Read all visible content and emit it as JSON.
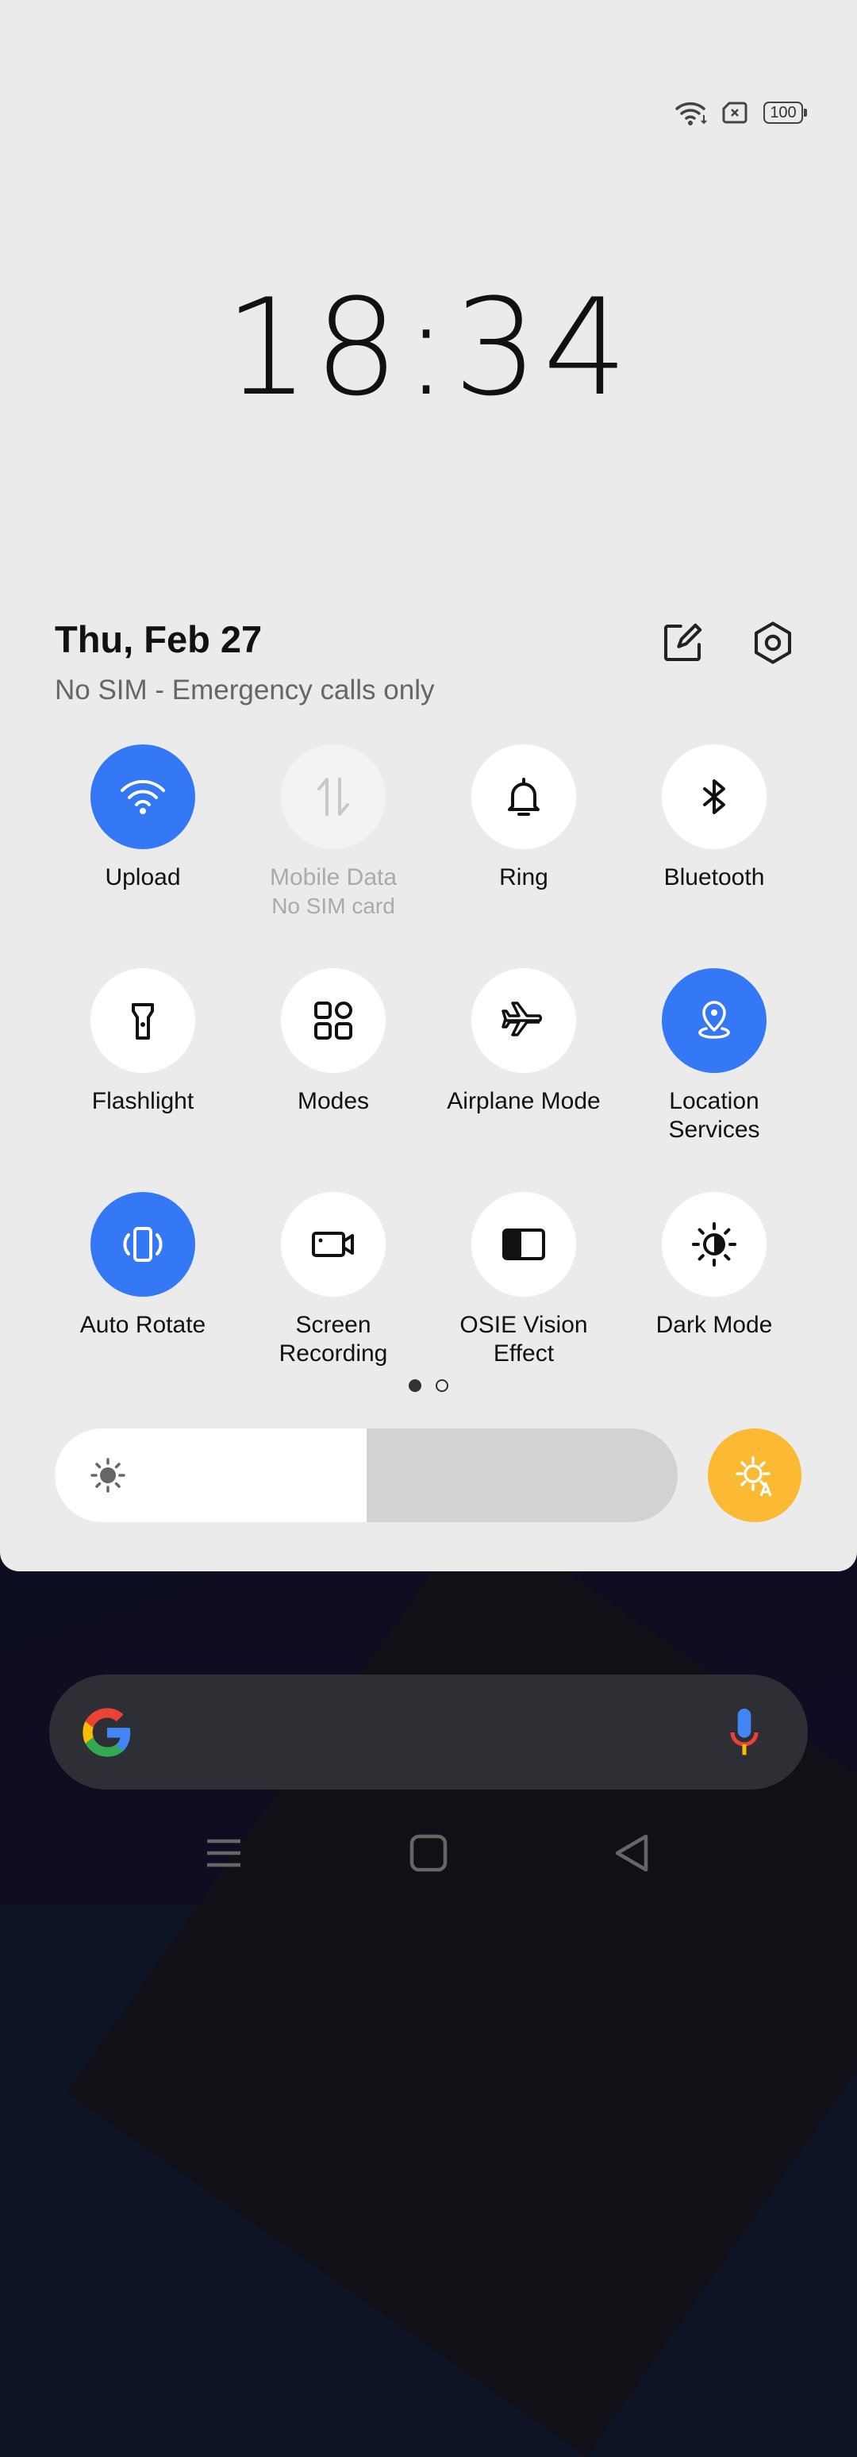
{
  "status_bar": {
    "battery": "100",
    "icons": [
      "wifi-icon",
      "no-sim-icon",
      "battery-icon"
    ]
  },
  "clock": "18:34",
  "header": {
    "date": "Thu, Feb 27",
    "sim_status": "No SIM - Emergency calls only",
    "edit_icon": "edit-icon",
    "settings_icon": "settings-icon"
  },
  "tiles": [
    {
      "label": "Upload",
      "icon": "wifi-icon",
      "state": "on"
    },
    {
      "label": "Mobile Data",
      "sub": "No SIM card",
      "icon": "mobile-data-icon",
      "state": "disabled"
    },
    {
      "label": "Ring",
      "icon": "bell-icon",
      "state": "off"
    },
    {
      "label": "Bluetooth",
      "icon": "bluetooth-icon",
      "state": "off"
    },
    {
      "label": "Flashlight",
      "icon": "flashlight-icon",
      "state": "off"
    },
    {
      "label": "Modes",
      "icon": "modes-grid-icon",
      "state": "off"
    },
    {
      "label": "Airplane Mode",
      "icon": "airplane-icon",
      "state": "off"
    },
    {
      "label": "Location\nServices",
      "icon": "location-icon",
      "state": "on"
    },
    {
      "label": "Auto Rotate",
      "icon": "auto-rotate-icon",
      "state": "on"
    },
    {
      "label": "Screen\nRecording",
      "icon": "screen-recording-icon",
      "state": "off"
    },
    {
      "label": "OSIE Vision\nEffect",
      "icon": "vision-effect-icon",
      "state": "off"
    },
    {
      "label": "Dark Mode",
      "icon": "dark-mode-icon",
      "state": "off"
    }
  ],
  "pager": {
    "pages": 2,
    "active": 0
  },
  "brightness": {
    "level": 0.5
  },
  "colors": {
    "accent_on": "#3478f6",
    "panel_bg": "#ebebeb",
    "auto_brightness": "#fbb934"
  }
}
